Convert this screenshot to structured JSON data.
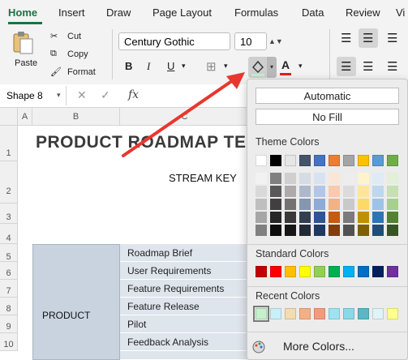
{
  "tabs": [
    "Home",
    "Insert",
    "Draw",
    "Page Layout",
    "Formulas",
    "Data",
    "Review",
    "Vi"
  ],
  "clipboard": {
    "paste": "Paste",
    "cut": "Cut",
    "copy": "Copy",
    "format": "Format"
  },
  "font": {
    "name": "Century Gothic",
    "size": "10",
    "bold": "B",
    "italic": "I",
    "underline": "U"
  },
  "namebox": "Shape 8",
  "fx": "fx",
  "columns": [
    "A",
    "B",
    "C"
  ],
  "rows": [
    "1",
    "2",
    "3",
    "4",
    "5",
    "6",
    "7",
    "8",
    "9",
    "10"
  ],
  "sheet": {
    "title": "PRODUCT ROADMAP TEM",
    "stream_key": "STREAM KEY",
    "product": "PRODUCT",
    "tasks": [
      "Roadmap Brief",
      "User Requirements",
      "Feature Requirements",
      "Feature Release",
      "Pilot",
      "Feedback Analysis"
    ]
  },
  "palette": {
    "automatic": "Automatic",
    "no_fill": "No Fill",
    "theme_label": "Theme Colors",
    "standard_label": "Standard Colors",
    "recent_label": "Recent Colors",
    "more": "More Colors...",
    "theme_top": [
      "#ffffff",
      "#000000",
      "#e7e6e6",
      "#44546a",
      "#4472c4",
      "#ed7d31",
      "#a5a5a5",
      "#ffc000",
      "#5b9bd5",
      "#70ad47"
    ],
    "theme_shades": [
      [
        "#f2f2f2",
        "#d9d9d9",
        "#bfbfbf",
        "#a6a6a6",
        "#808080"
      ],
      [
        "#808080",
        "#595959",
        "#404040",
        "#262626",
        "#0d0d0d"
      ],
      [
        "#d0cece",
        "#aeaaaa",
        "#757171",
        "#3a3838",
        "#171616"
      ],
      [
        "#d6dce4",
        "#adb9ca",
        "#8496b0",
        "#333f4f",
        "#222a35"
      ],
      [
        "#d9e2f3",
        "#b4c6e7",
        "#8eaadb",
        "#2f5496",
        "#1f3864"
      ],
      [
        "#fbe5d5",
        "#f7cbac",
        "#f4b183",
        "#c55a11",
        "#833c0b"
      ],
      [
        "#ededed",
        "#dbdbdb",
        "#c9c9c9",
        "#7b7b7b",
        "#525252"
      ],
      [
        "#fff2cc",
        "#fee599",
        "#ffd965",
        "#bf9000",
        "#7f6000"
      ],
      [
        "#deebf6",
        "#bdd7ee",
        "#9dc3e6",
        "#2e75b5",
        "#1f4e79"
      ],
      [
        "#e2efd9",
        "#c5e0b3",
        "#a8d08d",
        "#538135",
        "#375623"
      ]
    ],
    "standard": [
      "#c00000",
      "#ff0000",
      "#ffc000",
      "#ffff00",
      "#92d050",
      "#00b050",
      "#00b0f0",
      "#0070c0",
      "#002060",
      "#7030a0"
    ],
    "recent": [
      "#c6efce",
      "#c9f0f7",
      "#f2dcb2",
      "#f4b084",
      "#f49a7a",
      "#9ee3f0",
      "#8cd8e8",
      "#5bb6c6",
      "#dff3f8",
      "#ffff8c"
    ]
  }
}
